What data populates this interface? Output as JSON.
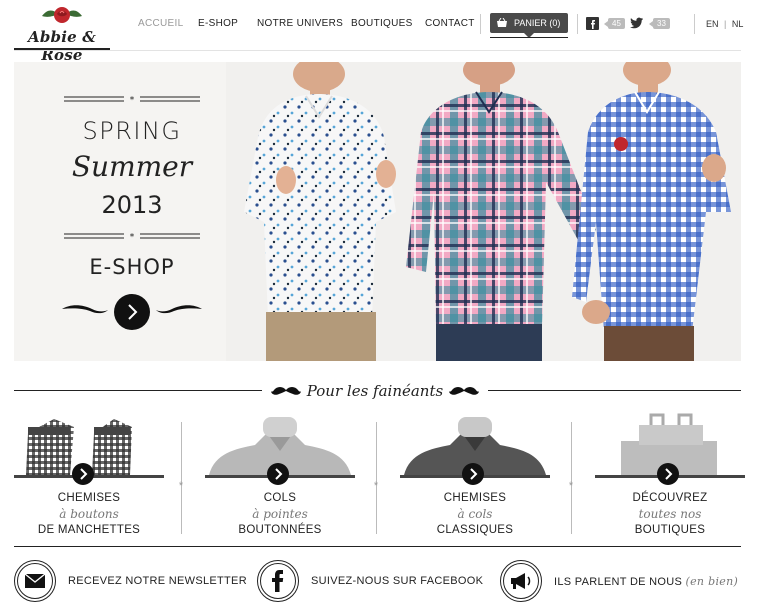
{
  "header": {
    "logo_text": "Abbie & Rose",
    "nav": [
      {
        "label": "ACCUEIL",
        "active": true
      },
      {
        "label": "E-SHOP",
        "active": false
      },
      {
        "label": "NOTRE UNIVERS",
        "active": false
      },
      {
        "label": "BOUTIQUES",
        "active": false
      },
      {
        "label": "CONTACT",
        "active": false
      }
    ],
    "cart_label": "PANIER (0)",
    "facebook_count": "45",
    "twitter_count": "33",
    "lang_en": "EN",
    "lang_divider": "|",
    "lang_nl": "NL"
  },
  "hero": {
    "line1": "SPRING",
    "line2": "Summer",
    "line3": "2013",
    "cta": "E-SHOP"
  },
  "section": {
    "title": "Pour les fainéants"
  },
  "products": [
    {
      "l1": "CHEMISES",
      "l2": "à boutons",
      "l3": "DE MANCHETTES"
    },
    {
      "l1": "COLS",
      "l2": "à pointes",
      "l3": "BOUTONNÉES"
    },
    {
      "l1": "CHEMISES",
      "l2": "à cols",
      "l3": "CLASSIQUES"
    },
    {
      "l1": "DÉCOUVREZ",
      "l2": "toutes nos",
      "l3": "BOUTIQUES"
    }
  ],
  "footer": {
    "newsletter": "RECEVEZ NOTRE NEWSLETTER",
    "facebook": "SUIVEZ-NOUS SUR FACEBOOK",
    "press": "ILS PARLENT DE NOUS",
    "press_em": "(en bien)"
  },
  "colors": {
    "accent": "#111111",
    "rose": "#c0272d",
    "leaf": "#3b6b34",
    "hero_bg": "#f0efed"
  },
  "icons": [
    "rose-icon",
    "basket-icon",
    "facebook-icon",
    "twitter-icon",
    "chevron-right-icon",
    "mustache-icon",
    "envelope-icon",
    "megaphone-icon"
  ]
}
